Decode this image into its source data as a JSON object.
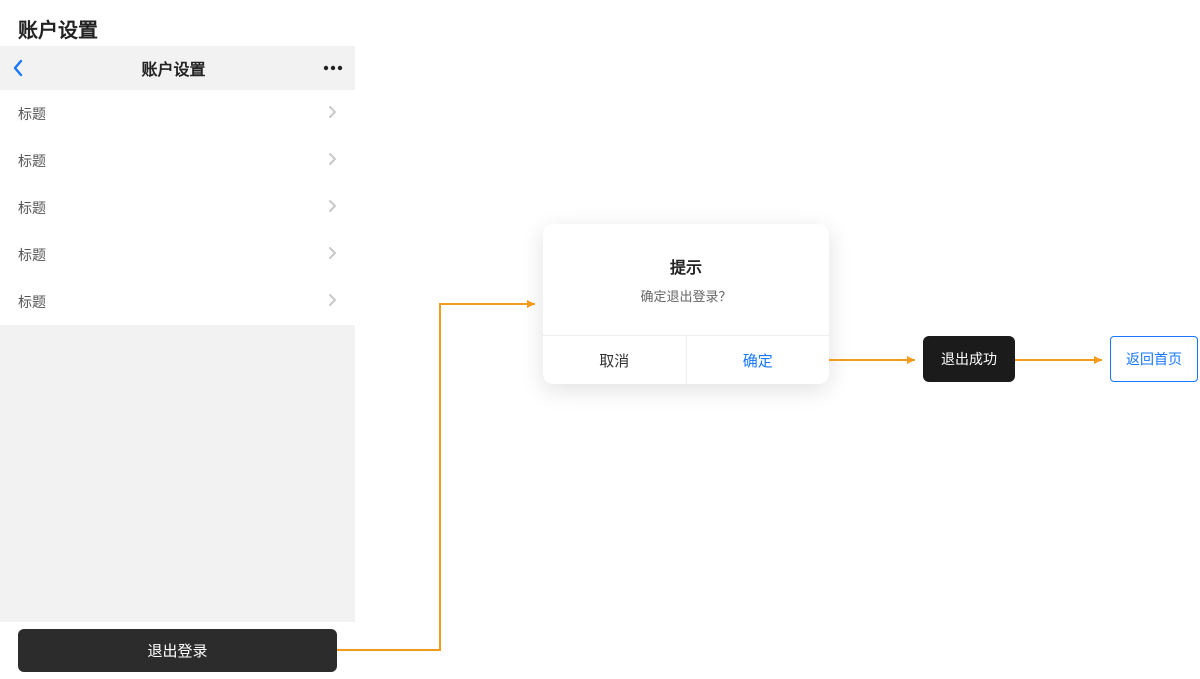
{
  "page": {
    "title": "账户设置"
  },
  "nav": {
    "title": "账户设置"
  },
  "list": {
    "item0": "标题",
    "item1": "标题",
    "item2": "标题",
    "item3": "标题",
    "item4": "标题"
  },
  "logout": {
    "label": "退出登录"
  },
  "modal": {
    "title": "提示",
    "message": "确定退出登录？",
    "cancel": "取消",
    "confirm": "确定"
  },
  "toast": {
    "text": "退出成功"
  },
  "home": {
    "label": "返回首页"
  }
}
